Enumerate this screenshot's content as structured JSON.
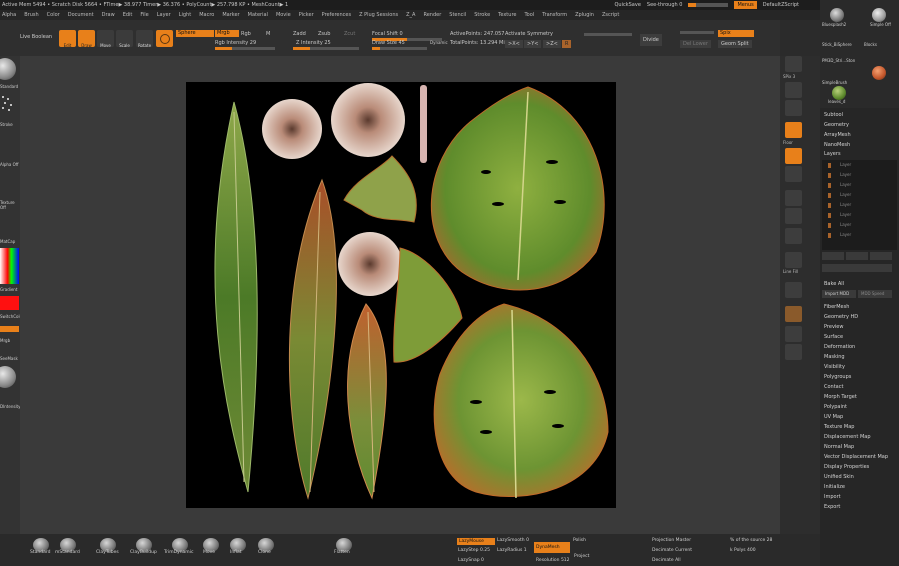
{
  "title_bar": {
    "text": "Active Mem 5494 • Scratch Disk 5664 • FTime▶ 38.977 Timer▶ 36.376 • PolyCount▶ 257.798 KP • MeshCount▶ 1",
    "quicksave": "QuickSave",
    "seethrough": "See-through 0",
    "menus_btn": "Menus",
    "script": "DefaultZScript"
  },
  "menubar": {
    "items": [
      "Alpha",
      "Brush",
      "Color",
      "Document",
      "Draw",
      "Edit",
      "File",
      "Layer",
      "Light",
      "Macro",
      "Marker",
      "Material",
      "Movie",
      "Picker",
      "Preferences",
      "Z Plug Sessions",
      "Z_A",
      "Render",
      "Stencil",
      "Stroke",
      "Texture",
      "Tool",
      "Transform",
      "Zplugin",
      "Zscript"
    ]
  },
  "toolbar": {
    "live_boolean": "Live Boolean",
    "edit": "Edit",
    "draw": "Draw",
    "move": "Move",
    "scale": "Scale",
    "rotate": "Rotate",
    "mrgb": "Mrgb",
    "rgb": "Rgb",
    "m": "M",
    "zadd": "Zadd",
    "zsub": "Zsub",
    "zcut": "Zcut",
    "rgb_intensity": "Rgb Intensity 29",
    "z_intensity": "Z Intensity 25",
    "focal_shift": "Focal Shift 0",
    "draw_size": "Draw Size 45",
    "dynamic": "Dynamic",
    "active_points": "ActivePoints: 247.057",
    "total_points": "TotalPoints: 13.294 Mil",
    "activate_symmetry": "Activate Symmetry",
    "sphere": "Sphere",
    "divide": "Divide",
    "del_lower": "Del Lower",
    "geom_split": "Geom Split",
    "spix": "Spix",
    "orange_btn": "",
    "x": ">X<",
    "y": ">Y<",
    "z": ">Z<",
    "r": "R"
  },
  "left_shelf": {
    "labels": [
      "Standard",
      "Stroke",
      "Alpha Off",
      "Texture Off",
      "MatCap",
      "Gradient",
      "SwitchColor",
      "Alternate",
      "Mrgb",
      "Inspect",
      "Forward",
      "SeeMask",
      "DIntensity"
    ]
  },
  "right_column": {
    "labels": [
      "BPR",
      "SPix 3",
      "Persp",
      "Floor",
      "Local",
      "Frame",
      "Move",
      "Zoom3D",
      "Rotate",
      "Line Fill",
      "PolyF",
      "Transp",
      "Solo",
      "Dynamic",
      "Xpose"
    ]
  },
  "right_panel": {
    "thumb_labels": [
      "Bluesplash2",
      "Simple Off",
      "Stick_BiSphere",
      "Blocks",
      "PM3D_Stri...Ston",
      "Stick_Ellipse",
      "SimpleBrush",
      "bluesplash01",
      "Sphere3D",
      "bluesplash01",
      "leaves_d"
    ],
    "sections": [
      "Subtool",
      "Geometry",
      "ArrayMesh",
      "NanoMesh",
      "Layers"
    ],
    "layers": [
      "Layer",
      "Layer",
      "Layer",
      "Layer",
      "Layer",
      "Layer",
      "Layer",
      "Layer"
    ],
    "bake_all": "Bake All",
    "import_mdd": "Import MDD",
    "mdd_speed": "MDD Speed",
    "items": [
      "FiberMesh",
      "Geometry HD",
      "Preview",
      "Surface",
      "Deformation",
      "Masking",
      "Visibility",
      "Polygroups",
      "Contact",
      "Morph Target",
      "Polypaint",
      "UV Map",
      "Texture Map",
      "Displacement Map",
      "Normal Map",
      "Vector Displacement Map",
      "Display Properties",
      "Unified Skin",
      "Initialize",
      "Import",
      "Export"
    ]
  },
  "bottom_shelf": {
    "brushes": [
      "Standard",
      "mStandard",
      "ClayTubes",
      "ClayBuildup",
      "TrimDynamic",
      "Move",
      "Inflat",
      "Clone",
      "Slash3",
      "Flatten"
    ],
    "lazy_mouse": "LazyMouse",
    "lazy_smooth": "LazySmooth 0",
    "lazy_step": "LazyStep 0.25",
    "lazy_radius": "LazyRadius 1",
    "lazy_snap": "LazySnap 0",
    "dynamesh": "DynaMesh",
    "polish": "Polish",
    "resolution": "Resolution 512",
    "project": "Project",
    "projection_master": "Projection Master",
    "decimate_current": "Decimate Current",
    "decimate_all": "Decimate All",
    "poly_ratio": "% of the source 28",
    "k_polys": "k Polys 400"
  },
  "document": {
    "leaf_colors": [
      "#5c8a2e",
      "#8aa83b",
      "#a9562b",
      "#c87a3a",
      "#3f6f21"
    ]
  }
}
